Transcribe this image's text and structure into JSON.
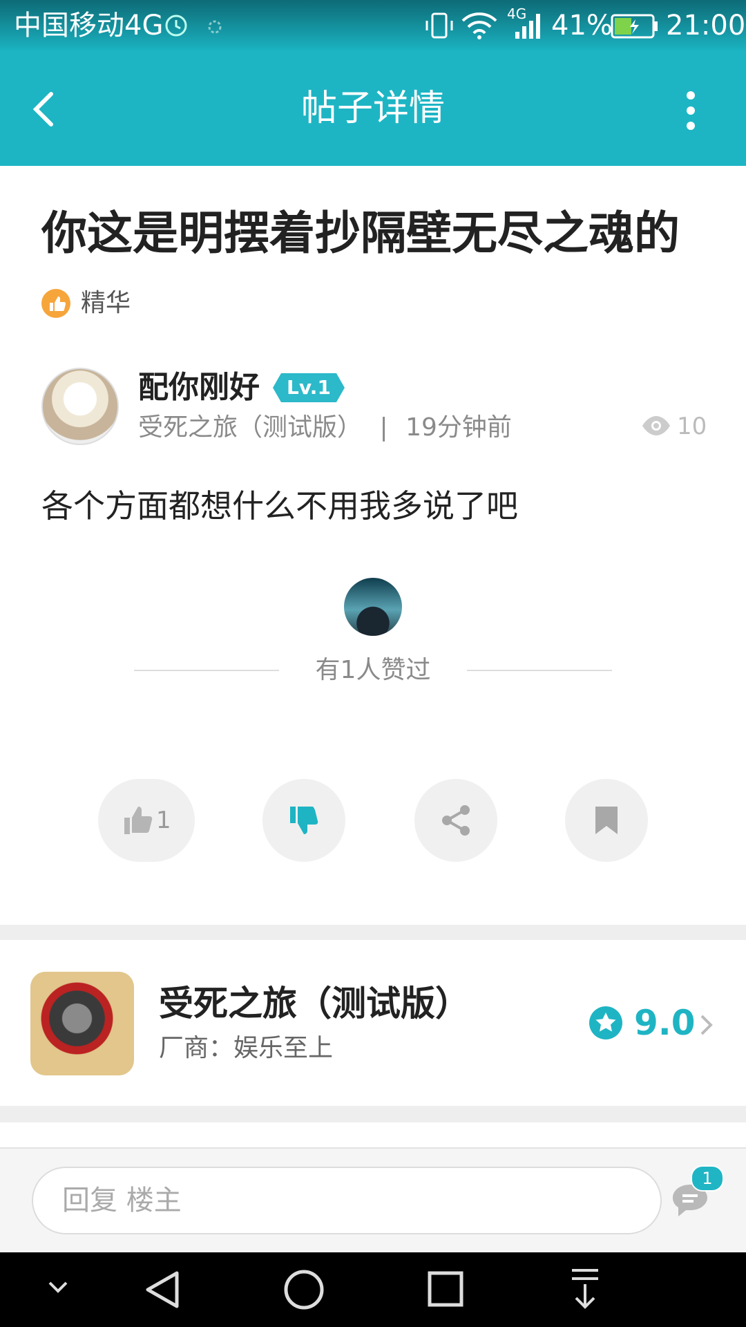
{
  "status_bar": {
    "carrier": "中国移动4G",
    "battery": "41%",
    "time": "21:00",
    "network": "4G"
  },
  "header": {
    "title": "帖子详情"
  },
  "post": {
    "title": "你这是明摆着抄隔壁无尽之魂的",
    "tag": "精华",
    "author": {
      "name": "配你刚好",
      "level": "Lv.1"
    },
    "game_tag": "受死之旅（测试版）",
    "time_sep": "|",
    "time": "19分钟前",
    "views": "10",
    "content": "各个方面都想什么不用我多说了吧",
    "likes_text": "有1人赞过"
  },
  "actions": {
    "like_count": "1"
  },
  "game_card": {
    "name": "受死之旅（测试版）",
    "vendor": "厂商：娱乐至上",
    "score": "9.0"
  },
  "reply": {
    "placeholder": "回复  楼主",
    "comment_count": "1"
  },
  "colors": {
    "accent": "#1db5c4",
    "badge": "#f6a53b"
  }
}
